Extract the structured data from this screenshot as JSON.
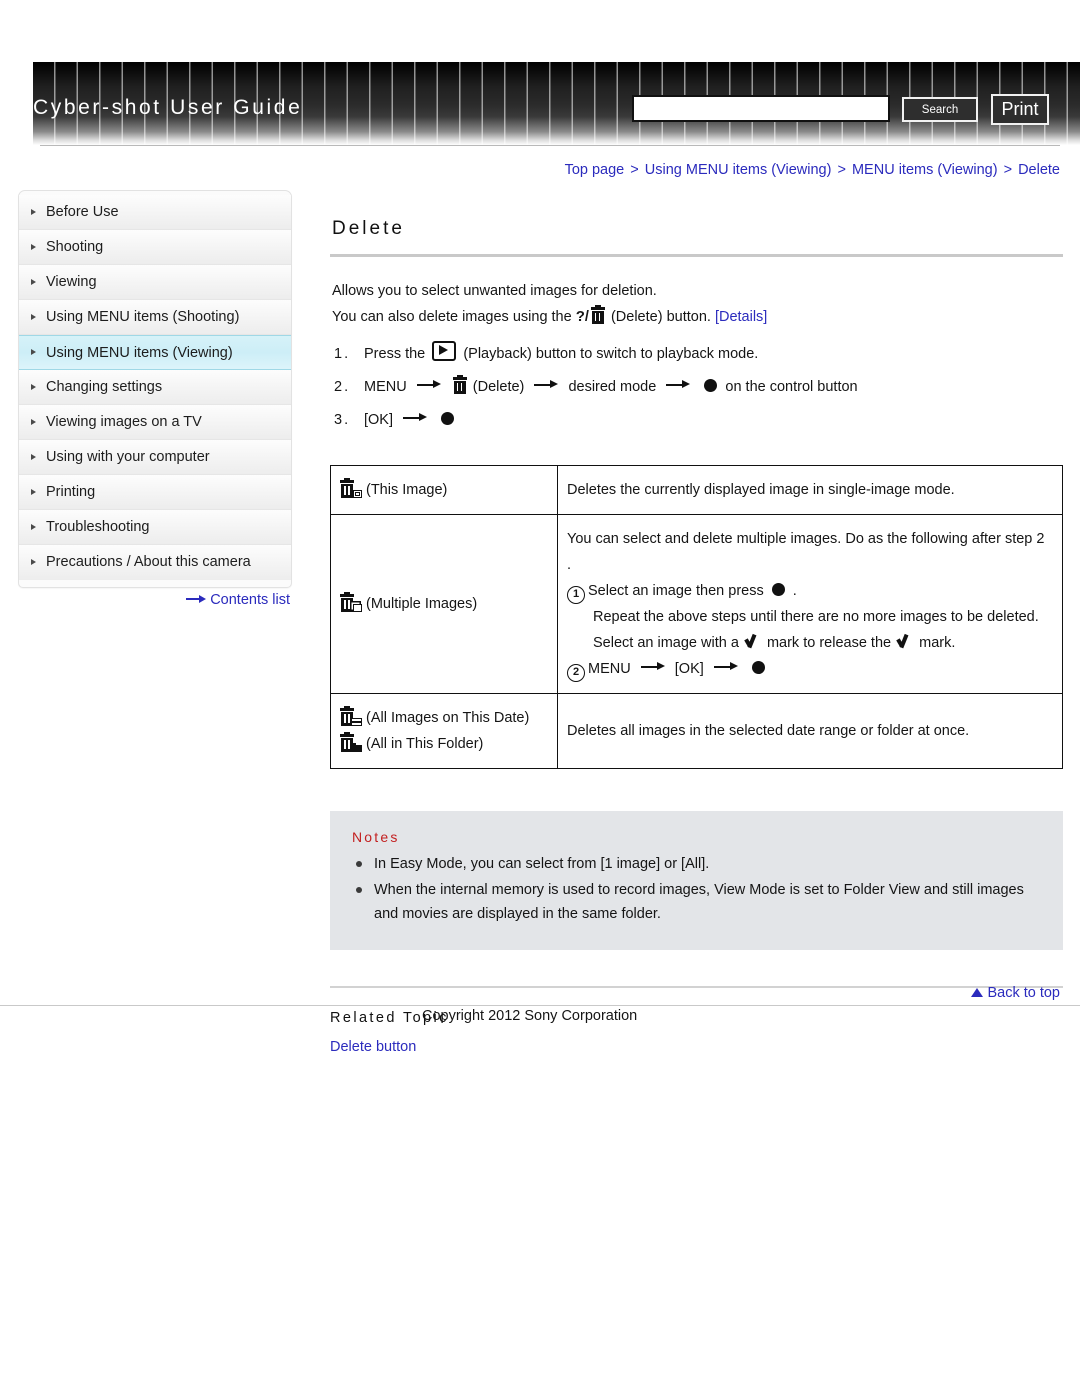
{
  "header": {
    "site_title": "Cyber-shot User Guide",
    "search_value": "",
    "search_placeholder": "",
    "search_button": "Search",
    "print_button": "Print"
  },
  "breadcrumb": {
    "items": [
      "Top page",
      "Using MENU items (Viewing)",
      "MENU items (Viewing)",
      "Delete"
    ],
    "separator": ">"
  },
  "sidebar": {
    "items": [
      {
        "label": "Before Use",
        "selected": false
      },
      {
        "label": "Shooting",
        "selected": false
      },
      {
        "label": "Viewing",
        "selected": false
      },
      {
        "label": "Using MENU items (Shooting)",
        "selected": false
      },
      {
        "label": "Using MENU items (Viewing)",
        "selected": true
      },
      {
        "label": "Changing settings",
        "selected": false
      },
      {
        "label": "Viewing images on a TV",
        "selected": false
      },
      {
        "label": "Using with your computer",
        "selected": false
      },
      {
        "label": "Printing",
        "selected": false
      },
      {
        "label": "Troubleshooting",
        "selected": false
      },
      {
        "label": "Precautions / About this camera",
        "selected": false
      }
    ],
    "contents_list_link": "Contents list"
  },
  "main": {
    "title": "Delete",
    "intro_line1": "Allows you to select unwanted images for deletion.",
    "intro_line2_before": "You can also delete images using the",
    "intro_line2_after": "(Delete) button.",
    "details_link": "[Details]",
    "steps": [
      {
        "num": "1.",
        "before": "Press the",
        "after": "(Playback) button to switch to playback mode."
      },
      {
        "num": "2.",
        "t1": "MENU",
        "t2": "(Delete)",
        "t3": "desired mode",
        "t4": "on the control button"
      },
      {
        "num": "3.",
        "t1": "[OK]"
      }
    ],
    "table": {
      "rows": [
        {
          "mode_label": "(This Image)",
          "mode_label2": "",
          "icon": "trash-single-image-icon",
          "icon2": "",
          "desc": "Deletes the currently displayed image in single-image mode."
        },
        {
          "mode_label": "(Multiple Images)",
          "mode_label2": "",
          "icon": "trash-multiple-images-icon",
          "icon2": "",
          "desc_intro": "You can select and delete multiple images. Do as the following after step 2 .",
          "step1_num": "1",
          "step1_before": "Select an image then press",
          "step1_after": ".",
          "step1_sub1": "Repeat the above steps until there are no more images to be deleted.",
          "step1_sub2_a": "Select an image with a",
          "step1_sub2_b": "mark to release the",
          "step1_sub2_c": "mark.",
          "step2_num": "2",
          "step2_t1": "MENU",
          "step2_t2": "[OK]"
        },
        {
          "mode_label": "(All Images on This Date)",
          "mode_label2": "(All in This Folder)",
          "icon": "trash-all-images-on-date-icon",
          "icon2": "trash-all-in-folder-icon",
          "desc": "Deletes all images in the selected date range or folder at once."
        }
      ]
    },
    "notes": {
      "title": "Notes",
      "items": [
        "In Easy Mode, you can select from [1 image] or [All].",
        "When the internal memory is used to record images, View Mode is set to Folder View and still images and movies are displayed in the same folder."
      ]
    },
    "related": {
      "title": "Related Topic",
      "link": "Delete button"
    }
  },
  "footer": {
    "back_to_top": "Back to top",
    "copyright": "Copyright 2012 Sony Corporation"
  }
}
